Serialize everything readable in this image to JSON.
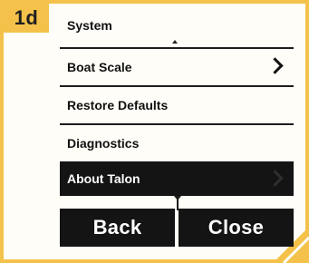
{
  "step": {
    "label": "1d"
  },
  "menu": {
    "items": [
      {
        "label": "System"
      },
      {
        "label": "Boat Scale"
      },
      {
        "label": "Restore Defaults"
      },
      {
        "label": "Diagnostics"
      },
      {
        "label": "About Talon",
        "selected": true
      }
    ]
  },
  "buttons": {
    "back": "Back",
    "close": "Close"
  },
  "colors": {
    "frame": "#f4c24a",
    "selected_bg": "#141414",
    "text": "#111111"
  }
}
